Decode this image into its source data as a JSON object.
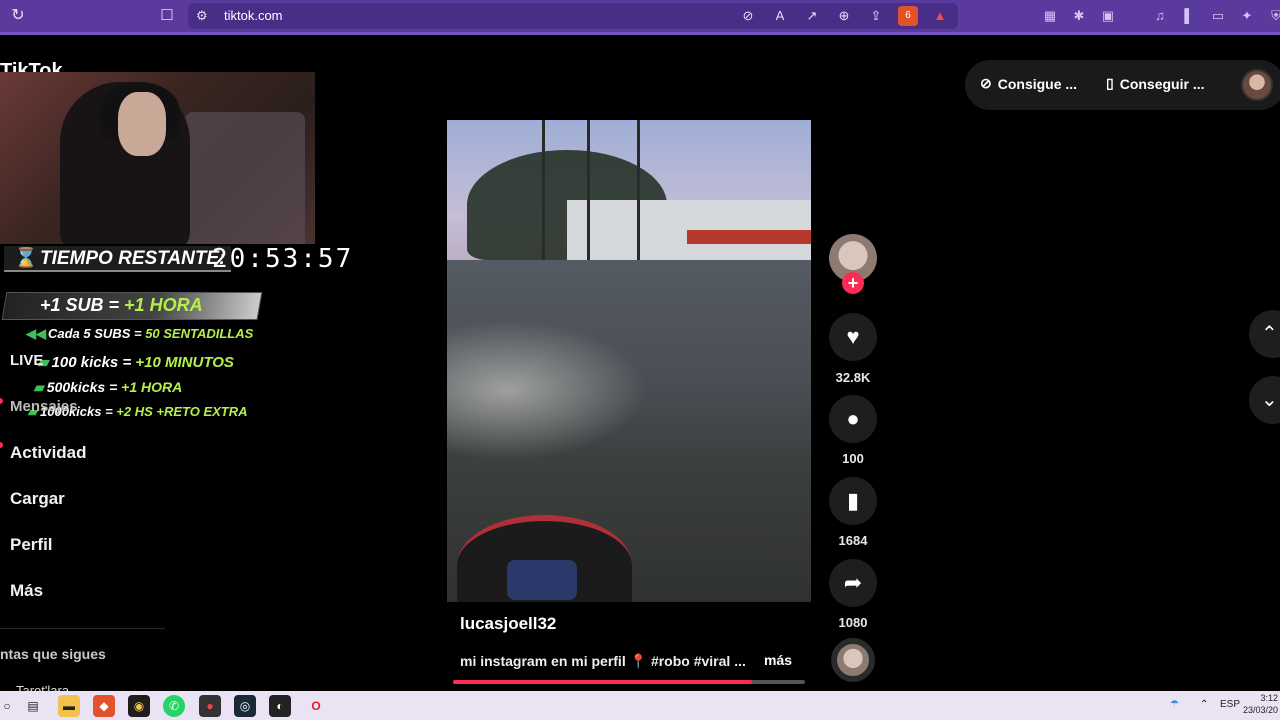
{
  "browser": {
    "url": "tiktok.com",
    "reload_icon": "reload-icon",
    "bookmark_icon": "bookmark-icon",
    "brave_shield_count": "6"
  },
  "overlay": {
    "logo_text": "TikTok",
    "timer_label": "TIEMPO RESTANTE:",
    "timer_value": "20:53:57",
    "sub_rule_a": "+1 SUB = ",
    "sub_rule_b": "+1 HORA",
    "rules": [
      {
        "a": "Cada 5 SUBS = ",
        "b": "50 SENTADILLAS"
      },
      {
        "a": "100 kicks = ",
        "b": "+10 MINUTOS"
      },
      {
        "a": "500kicks = ",
        "b": "+1 HORA"
      },
      {
        "a": "1000kicks = ",
        "b": "+2 HS +RETO EXTRA"
      }
    ]
  },
  "sidebar": {
    "live": "LIVE",
    "messages": "Mensajes",
    "activity": "Actividad",
    "upload": "Cargar",
    "profile": "Perfil",
    "more": "Más",
    "following_title": "ntas que sigues",
    "following_user": "Tarot'lara"
  },
  "topbar": {
    "get_coins": "Consigue ...",
    "get_app": "Conseguir ..."
  },
  "video": {
    "author": "lucasjoell32",
    "caption_a": "mi instagram en mi perfil",
    "caption_b": "#robo #viral ...",
    "more": "más",
    "progress": 0.85
  },
  "actions": {
    "likes": "32.8K",
    "comments": "100",
    "saves": "1684",
    "shares": "1080"
  },
  "taskbar": {
    "language": "ESP",
    "time": "3:12",
    "date": "23/03/20"
  }
}
